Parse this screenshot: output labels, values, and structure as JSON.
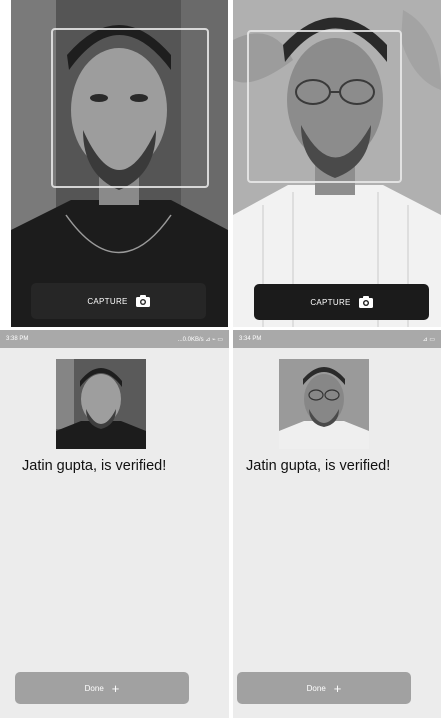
{
  "capture_screens": [
    {
      "button_label": "CAPTURE",
      "icon": "camera-icon"
    },
    {
      "button_label": "CAPTURE",
      "icon": "camera-icon"
    }
  ],
  "result_screens": [
    {
      "status_time": "3:38 PM",
      "status_right": "...0.0KB/s ⊿ ⌁ ▭",
      "verified_message": "Jatin gupta, is verified!",
      "done_label": "Done",
      "done_icon": "plus-icon"
    },
    {
      "status_time": "3:34 PM",
      "status_right": "⊿ ▭",
      "verified_message": "Jatin gupta, is verified!",
      "done_label": "Done",
      "done_icon": "plus-icon"
    }
  ],
  "colors": {
    "capture_bar": "#262626",
    "done_button": "#a1a1a1",
    "result_background": "#ececec"
  }
}
